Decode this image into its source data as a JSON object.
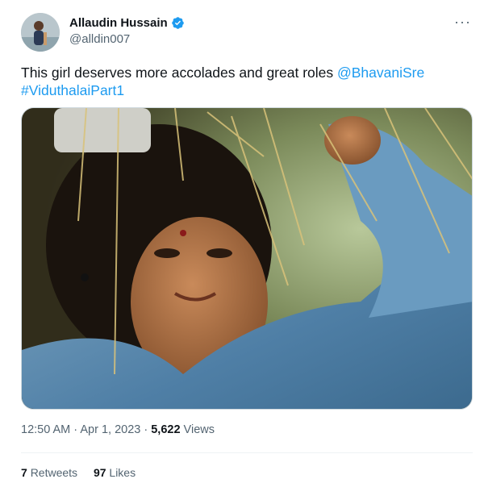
{
  "user": {
    "display_name": "Allaudin Hussain",
    "handle": "@alldin007",
    "verified": true,
    "verified_color": "#1d9bf0"
  },
  "more_label": "···",
  "tweet": {
    "text": "This girl deserves more accolades and great roles ",
    "mention": "@BhavaniSre",
    "hashtag": "#ViduthalaiPart1"
  },
  "meta": {
    "time": "12:50 AM",
    "separator": " · ",
    "date": "Apr 1, 2023",
    "views_count": "5,622",
    "views_label": " Views"
  },
  "stats": {
    "retweets_count": "7",
    "retweets_label": "Retweets",
    "likes_count": "97",
    "likes_label": "Likes"
  },
  "colors": {
    "link": "#1d9bf0",
    "secondary": "#536471"
  }
}
